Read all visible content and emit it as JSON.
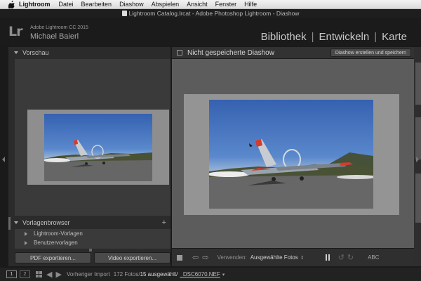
{
  "menubar": {
    "app": "Lightroom",
    "items": [
      "Datei",
      "Bearbeiten",
      "Diashow",
      "Abspielen",
      "Ansicht",
      "Fenster",
      "Hilfe"
    ]
  },
  "window": {
    "title": "Lightroom Catalog.lrcat - Adobe Photoshop Lightroom - Diashow"
  },
  "identity": {
    "logo": "Lr",
    "version": "Adobe Lightroom CC 2015",
    "user": "Michael Baierl"
  },
  "modules": [
    "Bibliothek",
    "Entwickeln",
    "Karte"
  ],
  "left_panel": {
    "preview_header": "Vorschau",
    "templates_header": "Vorlagenbrowser",
    "templates_add": "+",
    "template_folders": [
      "Lightroom-Vorlagen",
      "Benutzervorlagen"
    ],
    "export_pdf": "PDF exportieren...",
    "export_video": "Video exportieren..."
  },
  "center": {
    "title": "Nicht gespeicherte Diashow",
    "create_button": "Diashow erstellen und speichern"
  },
  "toolbar": {
    "use_label": "Verwenden:",
    "use_value": "Ausgewählte Fotos",
    "text_button": "ABC"
  },
  "filmstrip_bar": {
    "screen1": "1",
    "screen2": "2",
    "source": "Vorheriger Import",
    "count": "172 Fotos/",
    "selected": "15 ausgewählt/",
    "filename": "_DSC6070.NEF"
  },
  "colors": {
    "app_background": "#1a1a1a",
    "panel": "#2b2b2b",
    "stage": "#5c5c5c",
    "slide": "#949494"
  }
}
